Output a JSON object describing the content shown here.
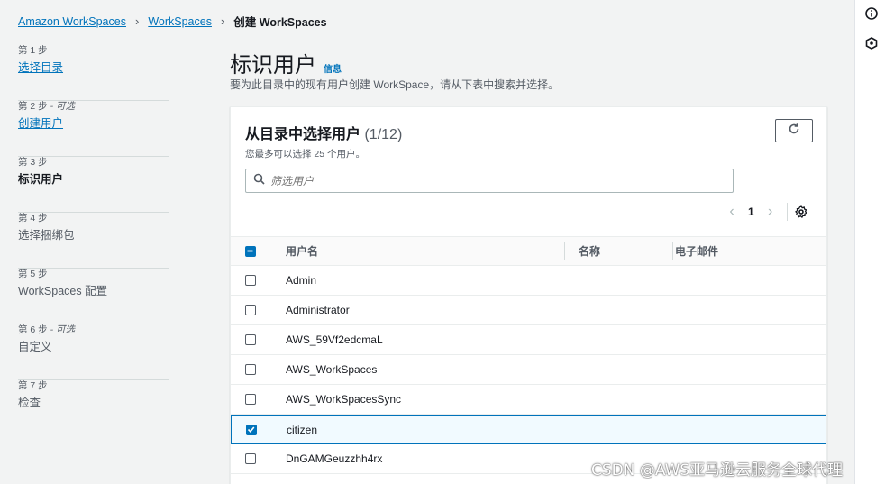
{
  "breadcrumb": [
    {
      "label": "Amazon WorkSpaces",
      "link": true
    },
    {
      "label": "WorkSpaces",
      "link": true
    },
    {
      "label": "创建 WorkSpaces",
      "link": false
    }
  ],
  "steps": [
    {
      "num": "第 1 步",
      "optional": "",
      "title": "选择目录",
      "state": "link"
    },
    {
      "num": "第 2 步",
      "optional": " - 可选",
      "title": "创建用户",
      "state": "link"
    },
    {
      "num": "第 3 步",
      "optional": "",
      "title": "标识用户",
      "state": "active"
    },
    {
      "num": "第 4 步",
      "optional": "",
      "title": "选择捆绑包",
      "state": "plain"
    },
    {
      "num": "第 5 步",
      "optional": "",
      "title": "WorkSpaces 配置",
      "state": "plain"
    },
    {
      "num": "第 6 步",
      "optional": " - 可选",
      "title": "自定义",
      "state": "plain"
    },
    {
      "num": "第 7 步",
      "optional": "",
      "title": "检查",
      "state": "plain"
    }
  ],
  "page": {
    "title": "标识用户",
    "info": "信息",
    "description": "要为此目录中的现有用户创建 WorkSpace，请从下表中搜索并选择。"
  },
  "panel": {
    "title": "从目录中选择用户",
    "count": "(1/12)",
    "subtitle": "您最多可以选择 25 个用户。",
    "search_placeholder": "筛选用户",
    "current_page": "1"
  },
  "table": {
    "columns": [
      "用户名",
      "名称",
      "电子邮件"
    ],
    "rows": [
      {
        "username": "Admin",
        "name": "",
        "email": "",
        "checked": false
      },
      {
        "username": "Administrator",
        "name": "",
        "email": "",
        "checked": false
      },
      {
        "username": "AWS_59Vf2edcmaL",
        "name": "",
        "email": "",
        "checked": false
      },
      {
        "username": "AWS_WorkSpaces",
        "name": "",
        "email": "",
        "checked": false
      },
      {
        "username": "AWS_WorkSpacesSync",
        "name": "",
        "email": "",
        "checked": false
      },
      {
        "username": "citizen",
        "name": "",
        "email": "",
        "checked": true
      },
      {
        "username": "DnGAMGeuzzhh4rx",
        "name": "",
        "email": "",
        "checked": false
      }
    ]
  },
  "watermark": "CSDN @AWS亚马逊云服务全球代理",
  "colors": {
    "link": "#0073bb",
    "selected_bg": "#f1faff",
    "background": "#f2f3f3"
  },
  "icons": [
    "info-icon",
    "hexagon-icon",
    "refresh-icon",
    "search-icon",
    "chevron-left-icon",
    "chevron-right-icon",
    "gear-icon"
  ]
}
